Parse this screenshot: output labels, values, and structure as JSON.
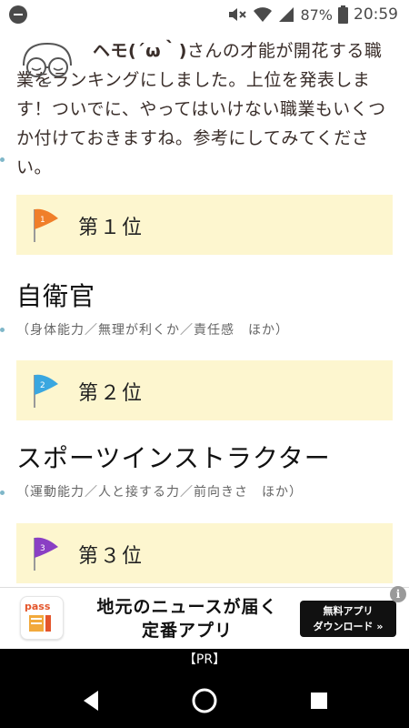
{
  "status_bar": {
    "battery_percent": "87%",
    "time": "20:59"
  },
  "intro": {
    "name": "ヘモ(´ω｀)",
    "text": "さんの才能が開花する職業をランキングにしました。上位を発表します！ついでに、やってはいけない職業もいくつか付けておきますね。参考にしてみてください。"
  },
  "rankings": [
    {
      "label": "第１位",
      "flag_color": "#f07f2a",
      "flag_number": "1",
      "job": "自衛官",
      "tags": "（身体能力／無理が利くか／責任感　ほか）"
    },
    {
      "label": "第２位",
      "flag_color": "#3aa7e0",
      "flag_number": "2",
      "job": "スポーツインストラクター",
      "tags": "（運動能力／人と接する力／前向きさ　ほか）"
    },
    {
      "label": "第３位",
      "flag_color": "#8a3fc4",
      "flag_number": "3"
    }
  ],
  "ad": {
    "logo_text": "pass",
    "headline_line1": "地元のニュースが届く",
    "headline_line2": "定番アプリ",
    "cta_line1": "無料アプリ",
    "cta_line2": "ダウンロード »",
    "info_icon": "i"
  },
  "pr_label": "【PR】",
  "colors": {
    "rank_box_bg": "#fdf6cf",
    "nav_bg": "#000000"
  }
}
